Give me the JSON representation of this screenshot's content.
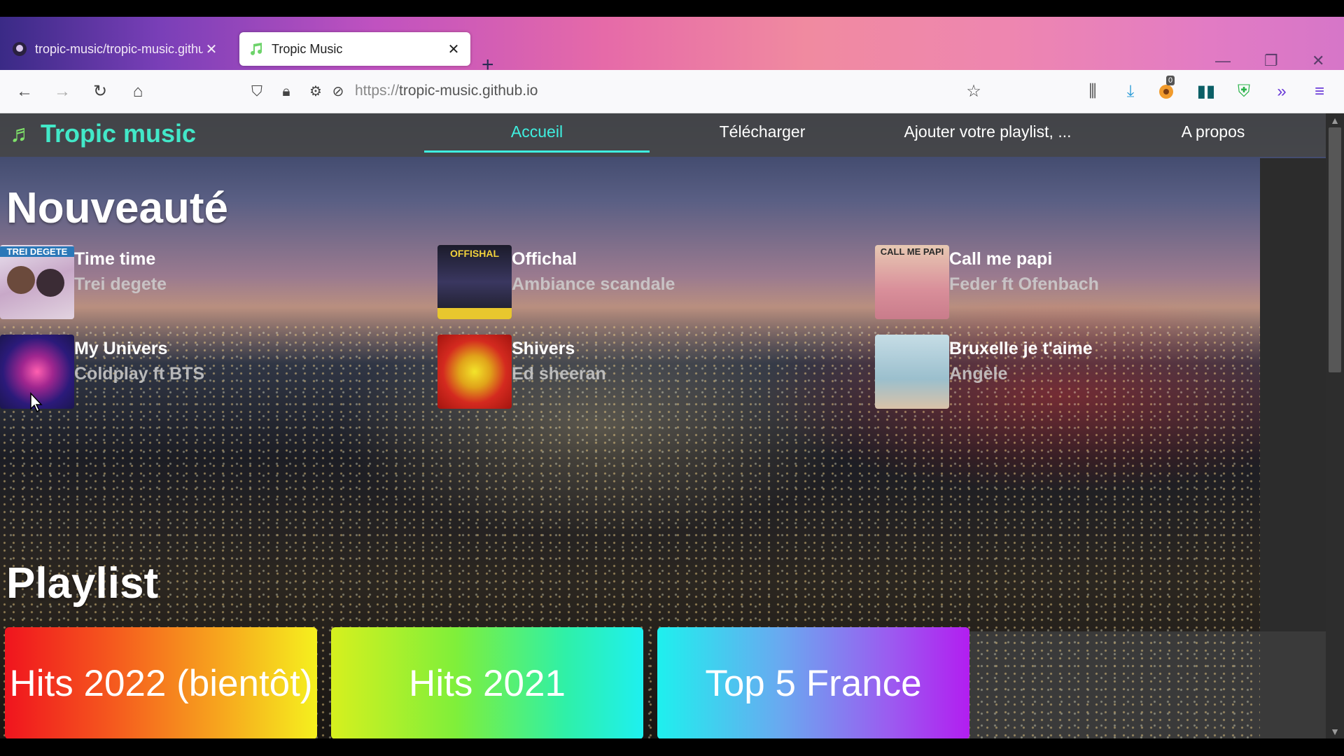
{
  "browser": {
    "tabs": [
      {
        "title": "tropic-music/tropic-music.githu",
        "favicon": "github-icon",
        "active": false
      },
      {
        "title": "Tropic Music",
        "favicon": "music-note-icon",
        "active": true
      }
    ],
    "url_scheme": "https://",
    "url_host": "tropic-music.github.io",
    "extension_badge": "0"
  },
  "site": {
    "logo_text": "Tropic music",
    "nav": [
      "Accueil",
      "Télécharger",
      "Ajouter votre playlist, ...",
      "A propos"
    ],
    "active_nav": "Accueil"
  },
  "nouveaute": {
    "title": "Nouveauté",
    "songs": [
      {
        "title": "Time time",
        "artist": "Trei degete",
        "cover_text": "TREI DEGETE"
      },
      {
        "title": "Offichal",
        "artist": "Ambiance scandale",
        "cover_text": "OFFISHAL"
      },
      {
        "title": "Call me papi",
        "artist": "Feder ft Ofenbach",
        "cover_text": "CALL ME PAPI"
      },
      {
        "title": "My Univers",
        "artist": "Coldplay ft BTS",
        "cover_text": ""
      },
      {
        "title": "Shivers",
        "artist": "Ed sheeran",
        "cover_text": ""
      },
      {
        "title": "Bruxelle je t'aime",
        "artist": "Angèle",
        "cover_text": ""
      }
    ]
  },
  "playlist": {
    "title": "Playlist",
    "cards": [
      "Hits 2022 (bientôt)",
      "Hits 2021",
      "Top 5 France"
    ]
  },
  "colors": {
    "accent": "#3ff0e0",
    "logo": "#42e8c8"
  }
}
